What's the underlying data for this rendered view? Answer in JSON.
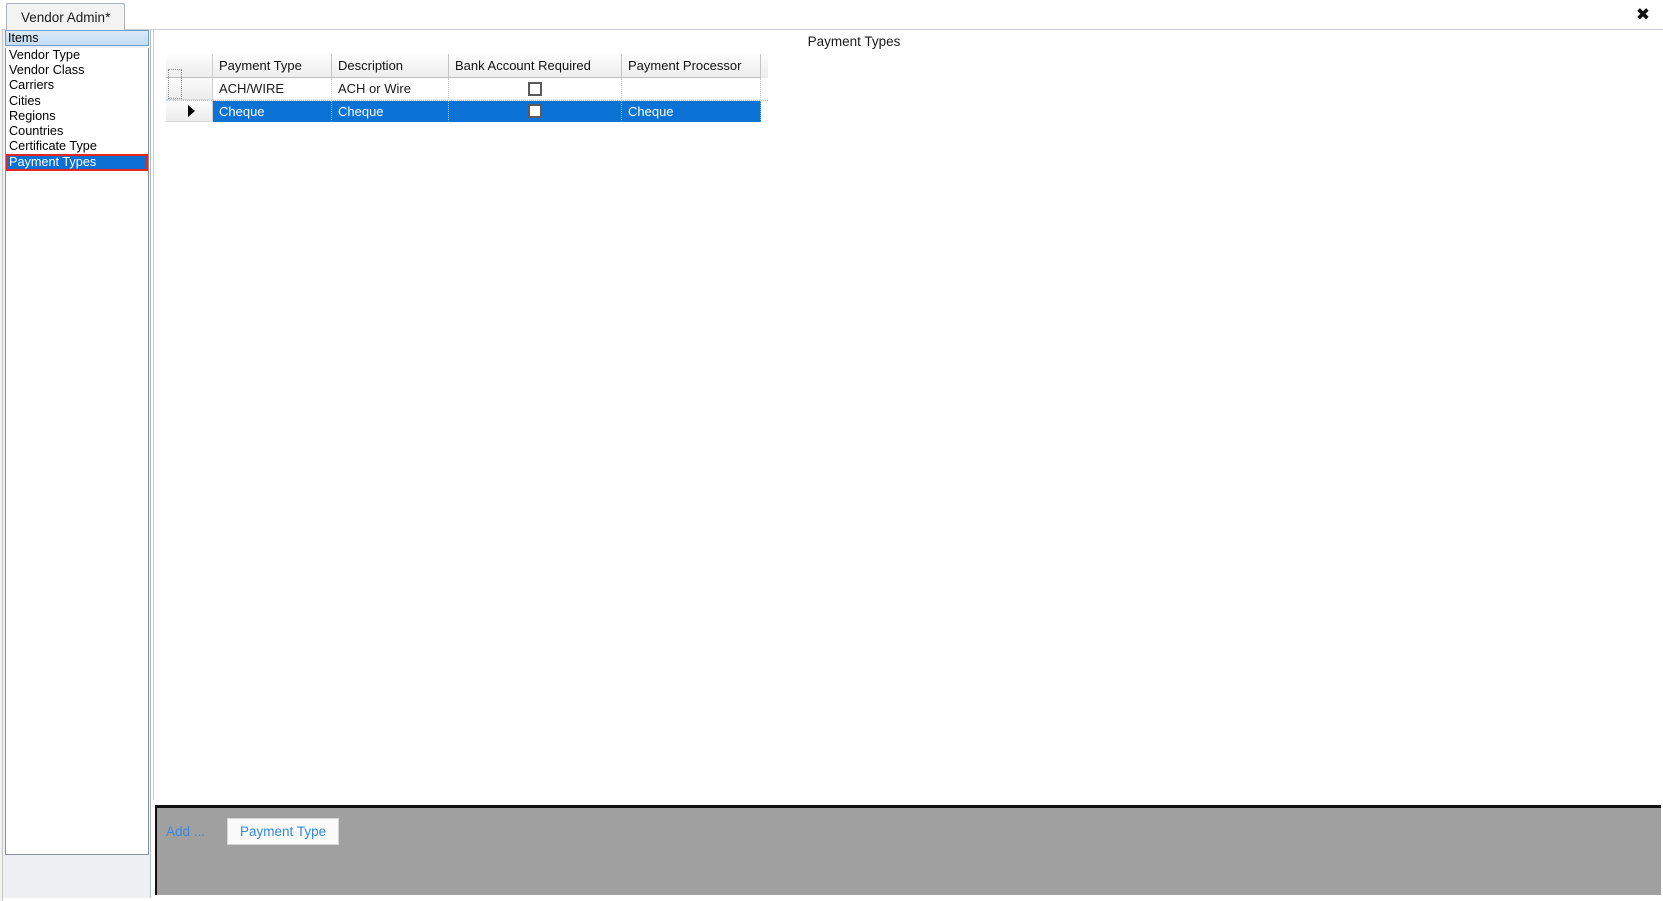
{
  "window": {
    "tab_label": "Vendor Admin",
    "tab_dirty_marker": "*",
    "close_icon": "close-icon",
    "close_glyph": "✖"
  },
  "sidebar": {
    "header": "Items",
    "items": [
      {
        "label": "Vendor Type",
        "selected": false
      },
      {
        "label": "Vendor Class",
        "selected": false
      },
      {
        "label": "Carriers",
        "selected": false
      },
      {
        "label": "Cities",
        "selected": false
      },
      {
        "label": "Regions",
        "selected": false
      },
      {
        "label": "Countries",
        "selected": false
      },
      {
        "label": "Certificate Type",
        "selected": false
      },
      {
        "label": "Payment Types",
        "selected": true
      }
    ],
    "selected_highlight_color": "#0b6fd4",
    "selected_border_color": "#e8261f"
  },
  "main": {
    "title": "Payment Types",
    "grid": {
      "columns": [
        "Payment Type",
        "Description",
        "Bank Account Required",
        "Payment Processor"
      ],
      "rows": [
        {
          "payment_type": "ACH/WIRE",
          "description": "ACH or Wire",
          "bank_account_required": false,
          "payment_processor": "",
          "selected": false,
          "row_marker": ""
        },
        {
          "payment_type": "Cheque",
          "description": "Cheque",
          "bank_account_required": false,
          "payment_processor": "Cheque",
          "selected": true,
          "row_marker": "▶"
        }
      ],
      "selected_row_color": "#0b72d6"
    }
  },
  "toolbar": {
    "add_label": "Add ...",
    "add_button_label": "Payment Type",
    "background_color": "#a0a0a0",
    "link_color": "#2f87e0"
  }
}
